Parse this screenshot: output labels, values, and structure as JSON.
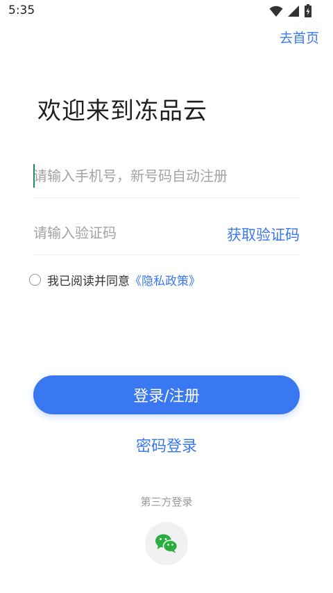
{
  "status_bar": {
    "time": "5:35",
    "icons": [
      "wifi-icon",
      "signal-icon",
      "battery-icon"
    ]
  },
  "header": {
    "home_link": "去首页"
  },
  "main": {
    "title": "欢迎来到冻品云",
    "phone_placeholder": "请输入手机号，新号码自动注册",
    "phone_value": "",
    "code_placeholder": "请输入验证码",
    "code_value": "",
    "get_code_label": "获取验证码",
    "agreement_text": "我已阅读并同意",
    "privacy_link": "《隐私政策》",
    "agreement_checked": false,
    "login_button": "登录/注册",
    "password_login": "密码登录",
    "third_party_label": "第三方登录",
    "third_party_icon": "wechat-icon"
  },
  "colors": {
    "accent": "#3a78f2",
    "wechat": "#2aae3f",
    "cursor": "#1e8a74"
  }
}
